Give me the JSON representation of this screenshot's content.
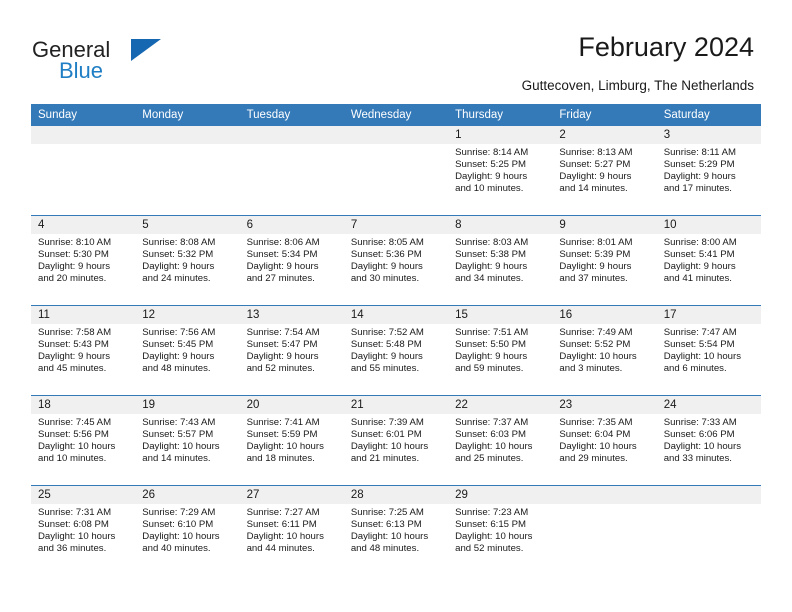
{
  "logo": {
    "word_top": "General",
    "word_bottom": "Blue",
    "icon": "triangle-flag-icon"
  },
  "header": {
    "title": "February 2024",
    "location": "Guttecoven, Limburg, The Netherlands"
  },
  "colors": {
    "header_blue": "#3479b8",
    "logo_blue": "#1f7ec4",
    "daynum_band": "#f0f0f0",
    "text": "#1a1a1a"
  },
  "calendar": {
    "weekday_headers": [
      "Sunday",
      "Monday",
      "Tuesday",
      "Wednesday",
      "Thursday",
      "Friday",
      "Saturday"
    ],
    "weeks": [
      [
        {
          "day": "",
          "lines": []
        },
        {
          "day": "",
          "lines": []
        },
        {
          "day": "",
          "lines": []
        },
        {
          "day": "",
          "lines": []
        },
        {
          "day": "1",
          "lines": [
            "Sunrise: 8:14 AM",
            "Sunset: 5:25 PM",
            "Daylight: 9 hours",
            "and 10 minutes."
          ]
        },
        {
          "day": "2",
          "lines": [
            "Sunrise: 8:13 AM",
            "Sunset: 5:27 PM",
            "Daylight: 9 hours",
            "and 14 minutes."
          ]
        },
        {
          "day": "3",
          "lines": [
            "Sunrise: 8:11 AM",
            "Sunset: 5:29 PM",
            "Daylight: 9 hours",
            "and 17 minutes."
          ]
        }
      ],
      [
        {
          "day": "4",
          "lines": [
            "Sunrise: 8:10 AM",
            "Sunset: 5:30 PM",
            "Daylight: 9 hours",
            "and 20 minutes."
          ]
        },
        {
          "day": "5",
          "lines": [
            "Sunrise: 8:08 AM",
            "Sunset: 5:32 PM",
            "Daylight: 9 hours",
            "and 24 minutes."
          ]
        },
        {
          "day": "6",
          "lines": [
            "Sunrise: 8:06 AM",
            "Sunset: 5:34 PM",
            "Daylight: 9 hours",
            "and 27 minutes."
          ]
        },
        {
          "day": "7",
          "lines": [
            "Sunrise: 8:05 AM",
            "Sunset: 5:36 PM",
            "Daylight: 9 hours",
            "and 30 minutes."
          ]
        },
        {
          "day": "8",
          "lines": [
            "Sunrise: 8:03 AM",
            "Sunset: 5:38 PM",
            "Daylight: 9 hours",
            "and 34 minutes."
          ]
        },
        {
          "day": "9",
          "lines": [
            "Sunrise: 8:01 AM",
            "Sunset: 5:39 PM",
            "Daylight: 9 hours",
            "and 37 minutes."
          ]
        },
        {
          "day": "10",
          "lines": [
            "Sunrise: 8:00 AM",
            "Sunset: 5:41 PM",
            "Daylight: 9 hours",
            "and 41 minutes."
          ]
        }
      ],
      [
        {
          "day": "11",
          "lines": [
            "Sunrise: 7:58 AM",
            "Sunset: 5:43 PM",
            "Daylight: 9 hours",
            "and 45 minutes."
          ]
        },
        {
          "day": "12",
          "lines": [
            "Sunrise: 7:56 AM",
            "Sunset: 5:45 PM",
            "Daylight: 9 hours",
            "and 48 minutes."
          ]
        },
        {
          "day": "13",
          "lines": [
            "Sunrise: 7:54 AM",
            "Sunset: 5:47 PM",
            "Daylight: 9 hours",
            "and 52 minutes."
          ]
        },
        {
          "day": "14",
          "lines": [
            "Sunrise: 7:52 AM",
            "Sunset: 5:48 PM",
            "Daylight: 9 hours",
            "and 55 minutes."
          ]
        },
        {
          "day": "15",
          "lines": [
            "Sunrise: 7:51 AM",
            "Sunset: 5:50 PM",
            "Daylight: 9 hours",
            "and 59 minutes."
          ]
        },
        {
          "day": "16",
          "lines": [
            "Sunrise: 7:49 AM",
            "Sunset: 5:52 PM",
            "Daylight: 10 hours",
            "and 3 minutes."
          ]
        },
        {
          "day": "17",
          "lines": [
            "Sunrise: 7:47 AM",
            "Sunset: 5:54 PM",
            "Daylight: 10 hours",
            "and 6 minutes."
          ]
        }
      ],
      [
        {
          "day": "18",
          "lines": [
            "Sunrise: 7:45 AM",
            "Sunset: 5:56 PM",
            "Daylight: 10 hours",
            "and 10 minutes."
          ]
        },
        {
          "day": "19",
          "lines": [
            "Sunrise: 7:43 AM",
            "Sunset: 5:57 PM",
            "Daylight: 10 hours",
            "and 14 minutes."
          ]
        },
        {
          "day": "20",
          "lines": [
            "Sunrise: 7:41 AM",
            "Sunset: 5:59 PM",
            "Daylight: 10 hours",
            "and 18 minutes."
          ]
        },
        {
          "day": "21",
          "lines": [
            "Sunrise: 7:39 AM",
            "Sunset: 6:01 PM",
            "Daylight: 10 hours",
            "and 21 minutes."
          ]
        },
        {
          "day": "22",
          "lines": [
            "Sunrise: 7:37 AM",
            "Sunset: 6:03 PM",
            "Daylight: 10 hours",
            "and 25 minutes."
          ]
        },
        {
          "day": "23",
          "lines": [
            "Sunrise: 7:35 AM",
            "Sunset: 6:04 PM",
            "Daylight: 10 hours",
            "and 29 minutes."
          ]
        },
        {
          "day": "24",
          "lines": [
            "Sunrise: 7:33 AM",
            "Sunset: 6:06 PM",
            "Daylight: 10 hours",
            "and 33 minutes."
          ]
        }
      ],
      [
        {
          "day": "25",
          "lines": [
            "Sunrise: 7:31 AM",
            "Sunset: 6:08 PM",
            "Daylight: 10 hours",
            "and 36 minutes."
          ]
        },
        {
          "day": "26",
          "lines": [
            "Sunrise: 7:29 AM",
            "Sunset: 6:10 PM",
            "Daylight: 10 hours",
            "and 40 minutes."
          ]
        },
        {
          "day": "27",
          "lines": [
            "Sunrise: 7:27 AM",
            "Sunset: 6:11 PM",
            "Daylight: 10 hours",
            "and 44 minutes."
          ]
        },
        {
          "day": "28",
          "lines": [
            "Sunrise: 7:25 AM",
            "Sunset: 6:13 PM",
            "Daylight: 10 hours",
            "and 48 minutes."
          ]
        },
        {
          "day": "29",
          "lines": [
            "Sunrise: 7:23 AM",
            "Sunset: 6:15 PM",
            "Daylight: 10 hours",
            "and 52 minutes."
          ]
        },
        {
          "day": "",
          "lines": []
        },
        {
          "day": "",
          "lines": []
        }
      ]
    ]
  }
}
